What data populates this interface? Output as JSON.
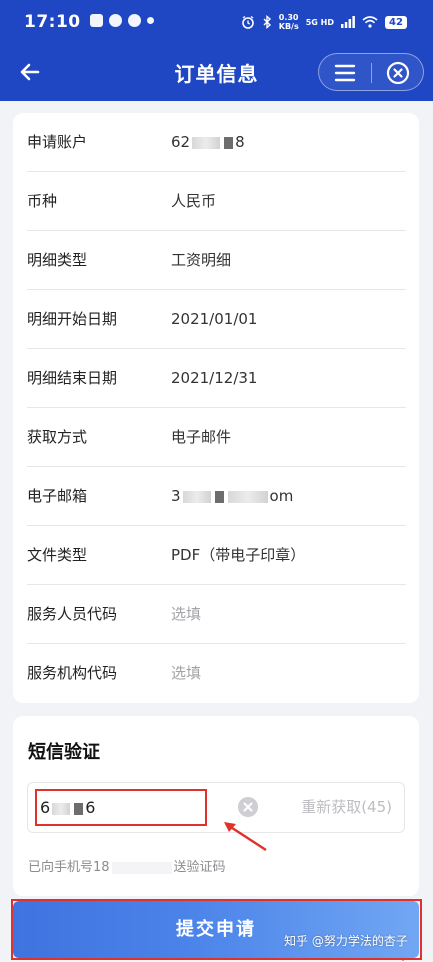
{
  "status_bar": {
    "time": "17:10",
    "net_speed_value": "0.30",
    "net_speed_unit": "KB/s",
    "network_label": "5G HD",
    "battery": "42"
  },
  "header": {
    "title": "订单信息"
  },
  "order_info": {
    "rows": [
      {
        "label": "申请账户",
        "value_start": "62",
        "value_end": "8"
      },
      {
        "label": "币种",
        "value": "人民币"
      },
      {
        "label": "明细类型",
        "value": "工资明细"
      },
      {
        "label": "明细开始日期",
        "value": "2021/01/01"
      },
      {
        "label": "明细结束日期",
        "value": "2021/12/31"
      },
      {
        "label": "获取方式",
        "value": "电子邮件"
      },
      {
        "label": "电子邮箱",
        "value_start": "3",
        "value_end": "om"
      },
      {
        "label": "文件类型",
        "value": "PDF（带电子印章）"
      },
      {
        "label": "服务人员代码",
        "value": "选填"
      },
      {
        "label": "服务机构代码",
        "value": "选填"
      }
    ]
  },
  "sms": {
    "title": "短信验证",
    "code_start": "6",
    "code_end": "6",
    "resend_label": "重新获取(45)",
    "sent_prefix": "已向手机号18",
    "sent_suffix": "送验证码"
  },
  "submit": {
    "label": "提交申请"
  },
  "watermark": "知乎 @努力学法的杏子",
  "colors": {
    "header_bg": "#1f47c4",
    "highlight_red": "#e0322c",
    "button_gradient_start": "#3f73e0",
    "button_gradient_end": "#71a7f3"
  }
}
